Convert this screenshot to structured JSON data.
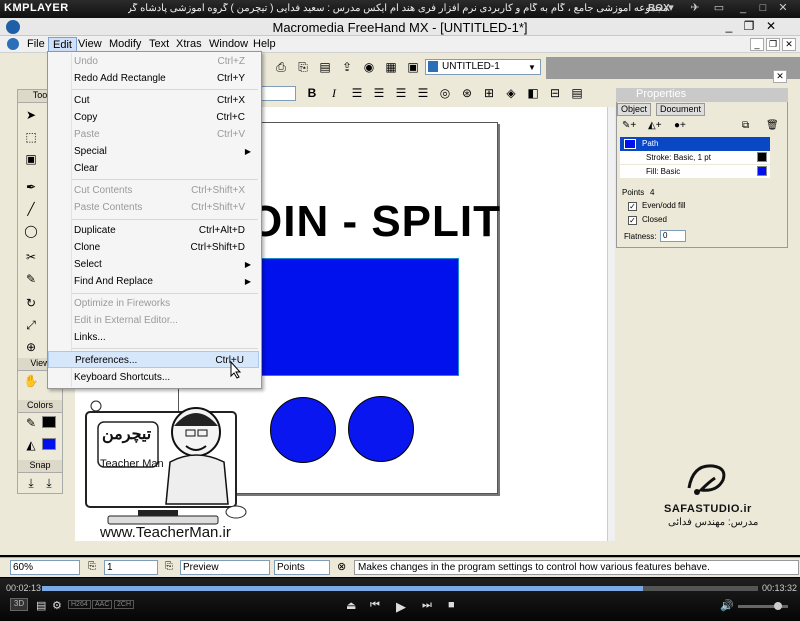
{
  "player": {
    "logo": "KMPLAYER",
    "title": "مجموعه آموزشی جامع ، گام به گام و کاربردی نرم افزار فری هند ام ایکس   مدرس : سعید فدایی ( تیچرمن ) گروه آموزشی پادشاه گرافیست ها",
    "box_label": "BOX",
    "time_current": "00:02:13",
    "time_total": "00:13:32",
    "progress": 0.84,
    "format_tags": [
      "H264",
      "AAC",
      "2CH"
    ]
  },
  "app": {
    "title": "Macromedia FreeHand MX - [UNTITLED-1*]",
    "menus": [
      "File",
      "Edit",
      "View",
      "Modify",
      "Text",
      "Xtras",
      "Window",
      "Help"
    ],
    "active_menu": "Edit",
    "document_select": "UNTITLED-1"
  },
  "edit_menu": [
    {
      "label": "Undo",
      "shortcut": "Ctrl+Z",
      "disabled": true
    },
    {
      "label": "Redo Add Rectangle",
      "shortcut": "Ctrl+Y"
    },
    {
      "sep": true
    },
    {
      "label": "Cut",
      "shortcut": "Ctrl+X"
    },
    {
      "label": "Copy",
      "shortcut": "Ctrl+C"
    },
    {
      "label": "Paste",
      "shortcut": "Ctrl+V",
      "disabled": true
    },
    {
      "label": "Special",
      "submenu": true
    },
    {
      "label": "Clear"
    },
    {
      "sep": true
    },
    {
      "label": "Cut Contents",
      "shortcut": "Ctrl+Shift+X",
      "disabled": true
    },
    {
      "label": "Paste Contents",
      "shortcut": "Ctrl+Shift+V",
      "disabled": true
    },
    {
      "sep": true
    },
    {
      "label": "Duplicate",
      "shortcut": "Ctrl+Alt+D"
    },
    {
      "label": "Clone",
      "shortcut": "Ctrl+Shift+D"
    },
    {
      "label": "Select",
      "submenu": true
    },
    {
      "label": "Find And Replace",
      "submenu": true
    },
    {
      "sep": true
    },
    {
      "label": "Optimize in Fireworks",
      "disabled": true
    },
    {
      "label": "Edit in External Editor...",
      "disabled": true
    },
    {
      "label": "Links..."
    },
    {
      "sep": true
    },
    {
      "label": "Preferences...",
      "shortcut": "Ctrl+U",
      "highlighted": true
    },
    {
      "label": "Keyboard Shortcuts..."
    }
  ],
  "toolbox": {
    "tools_header": "Too",
    "view_header": "View",
    "colors_header": "Colors",
    "snap_header": "Snap"
  },
  "canvas": {
    "heading_text": "OIN - SPLIT",
    "fill_color": "#0011ee"
  },
  "properties": {
    "title": "Properties",
    "tabs": [
      "Object",
      "Document"
    ],
    "path_label": "Path",
    "stroke_label": "Stroke: Basic, 1 pt",
    "fill_label": "Fill: Basic",
    "points_label": "Points",
    "points_value": "4",
    "evenodd_label": "Even/odd fill",
    "closed_label": "Closed",
    "flatness_label": "Flatness:",
    "flatness_value": "0"
  },
  "statusbar": {
    "zoom": "60%",
    "page": "1",
    "view_mode": "Preview",
    "units": "Points",
    "message": "Makes changes in the program settings to control how various features behave."
  },
  "branding": {
    "logo_fa": "تیچرمن",
    "logo_en": "Teacher Man",
    "url": "www.TeacherMan.ir",
    "studio": "SAFASTUDIO.ir",
    "instructor": "مدرس: مهندس فدائی"
  }
}
